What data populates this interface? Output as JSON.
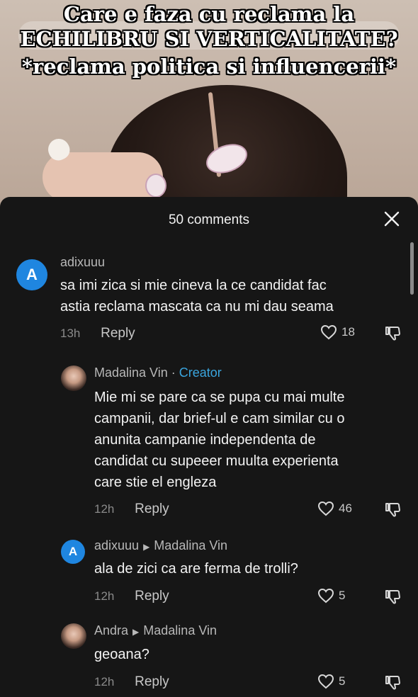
{
  "caption": {
    "line1": "Care e faza cu reclama la",
    "line2": "ECHILIBRU SI VERTICALITATE?",
    "line3": "*reclama politica si influencerii*"
  },
  "sheet": {
    "title": "50 comments"
  },
  "comments": [
    {
      "avatar_letter": "A",
      "username": "adixuuu",
      "text_lines": [
        "sa imi zica si mie cineva la ce candidat fac",
        "astia reclama mascata ca nu mi dau seama"
      ],
      "time": "13h",
      "reply_label": "Reply",
      "likes": "18"
    },
    {
      "username": "Madalina Vin",
      "separator": " · ",
      "creator_label": "Creator",
      "text_lines": [
        "Mie mi se pare ca se pupa cu mai multe",
        "campanii, dar brief-ul e cam similar cu o",
        "anunita campanie independenta de",
        "candidat cu supeeer muulta experienta",
        "care stie el engleza"
      ],
      "time": "12h",
      "reply_label": "Reply",
      "likes": "46"
    },
    {
      "avatar_letter": "A",
      "username": "adixuuu",
      "reply_to": "Madalina Vin",
      "text_lines": [
        "ala de zici ca are ferma de trolli?"
      ],
      "time": "12h",
      "reply_label": "Reply",
      "likes": "5"
    },
    {
      "username": "Andra",
      "reply_to": "Madalina Vin",
      "text_lines": [
        "geoana?"
      ],
      "time": "12h",
      "reply_label": "Reply",
      "likes": "5"
    }
  ],
  "icons": {
    "close": "close-icon",
    "like": "heart-icon",
    "dislike": "dislike-icon",
    "reply_arrow": "triangle-right-icon"
  },
  "colors": {
    "sheet_bg": "#161616",
    "creator_blue": "#3aa5de",
    "avatar_blue": "#1f86e0"
  }
}
